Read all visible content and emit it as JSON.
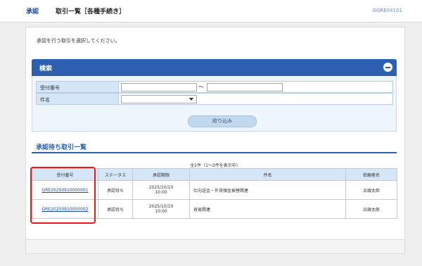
{
  "header": {
    "breadcrumb": "承認",
    "title": "取引一覧［各種手続き］",
    "screen_id": "GGRE04101"
  },
  "main": {
    "instruction": "承認を行う取引を選択してください。"
  },
  "search": {
    "title": "検索",
    "fields": {
      "receipt_number_label": "受付番号",
      "range_separator": "～",
      "subject_label": "件名"
    },
    "filter_button": "絞り込み"
  },
  "list": {
    "title": "承認待ち取引一覧",
    "count_text": "全2件（1～2件を表示中）",
    "columns": [
      "受付番号",
      "ステータス",
      "承認期限",
      "件名",
      "依頼者名"
    ],
    "rows": [
      {
        "receipt_number": "GRE20250910000001",
        "status": "承認待ち",
        "deadline_date": "2025/10/10",
        "deadline_time": "10:00",
        "subject": "仕向送金・外貨預金振替関連",
        "requester": "浜銀太郎"
      },
      {
        "receipt_number": "GRE20250910000002",
        "status": "承認待ち",
        "deadline_date": "2025/10/10",
        "deadline_time": "10:00",
        "subject": "貿易関連",
        "requester": "浜銀太郎"
      }
    ]
  },
  "colors": {
    "accent": "#2c5fb0",
    "highlight": "#e01c1c"
  },
  "icons": {
    "collapse": "minus-circle-icon",
    "select": "triangle-down-icon"
  }
}
